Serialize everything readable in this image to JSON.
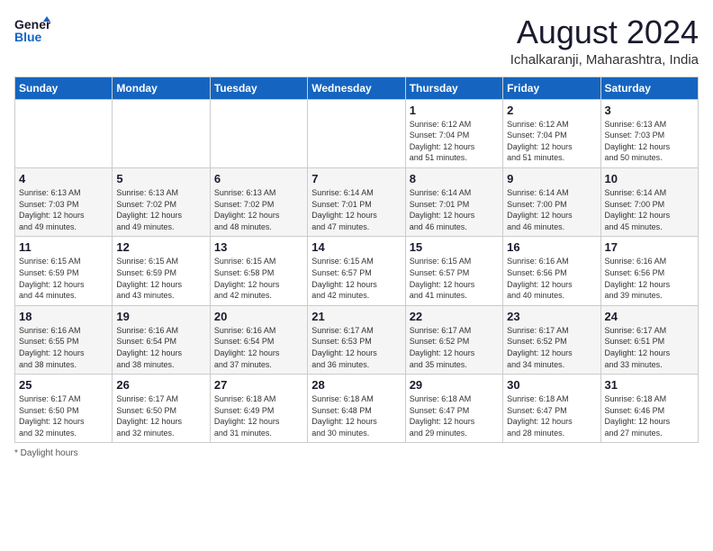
{
  "logo": {
    "line1": "General",
    "line2": "Blue"
  },
  "title": "August 2024",
  "location": "Ichalkaranji, Maharashtra, India",
  "days_of_week": [
    "Sunday",
    "Monday",
    "Tuesday",
    "Wednesday",
    "Thursday",
    "Friday",
    "Saturday"
  ],
  "footer": "Daylight hours",
  "weeks": [
    [
      {
        "day": "",
        "info": ""
      },
      {
        "day": "",
        "info": ""
      },
      {
        "day": "",
        "info": ""
      },
      {
        "day": "",
        "info": ""
      },
      {
        "day": "1",
        "info": "Sunrise: 6:12 AM\nSunset: 7:04 PM\nDaylight: 12 hours\nand 51 minutes."
      },
      {
        "day": "2",
        "info": "Sunrise: 6:12 AM\nSunset: 7:04 PM\nDaylight: 12 hours\nand 51 minutes."
      },
      {
        "day": "3",
        "info": "Sunrise: 6:13 AM\nSunset: 7:03 PM\nDaylight: 12 hours\nand 50 minutes."
      }
    ],
    [
      {
        "day": "4",
        "info": "Sunrise: 6:13 AM\nSunset: 7:03 PM\nDaylight: 12 hours\nand 49 minutes."
      },
      {
        "day": "5",
        "info": "Sunrise: 6:13 AM\nSunset: 7:02 PM\nDaylight: 12 hours\nand 49 minutes."
      },
      {
        "day": "6",
        "info": "Sunrise: 6:13 AM\nSunset: 7:02 PM\nDaylight: 12 hours\nand 48 minutes."
      },
      {
        "day": "7",
        "info": "Sunrise: 6:14 AM\nSunset: 7:01 PM\nDaylight: 12 hours\nand 47 minutes."
      },
      {
        "day": "8",
        "info": "Sunrise: 6:14 AM\nSunset: 7:01 PM\nDaylight: 12 hours\nand 46 minutes."
      },
      {
        "day": "9",
        "info": "Sunrise: 6:14 AM\nSunset: 7:00 PM\nDaylight: 12 hours\nand 46 minutes."
      },
      {
        "day": "10",
        "info": "Sunrise: 6:14 AM\nSunset: 7:00 PM\nDaylight: 12 hours\nand 45 minutes."
      }
    ],
    [
      {
        "day": "11",
        "info": "Sunrise: 6:15 AM\nSunset: 6:59 PM\nDaylight: 12 hours\nand 44 minutes."
      },
      {
        "day": "12",
        "info": "Sunrise: 6:15 AM\nSunset: 6:59 PM\nDaylight: 12 hours\nand 43 minutes."
      },
      {
        "day": "13",
        "info": "Sunrise: 6:15 AM\nSunset: 6:58 PM\nDaylight: 12 hours\nand 42 minutes."
      },
      {
        "day": "14",
        "info": "Sunrise: 6:15 AM\nSunset: 6:57 PM\nDaylight: 12 hours\nand 42 minutes."
      },
      {
        "day": "15",
        "info": "Sunrise: 6:15 AM\nSunset: 6:57 PM\nDaylight: 12 hours\nand 41 minutes."
      },
      {
        "day": "16",
        "info": "Sunrise: 6:16 AM\nSunset: 6:56 PM\nDaylight: 12 hours\nand 40 minutes."
      },
      {
        "day": "17",
        "info": "Sunrise: 6:16 AM\nSunset: 6:56 PM\nDaylight: 12 hours\nand 39 minutes."
      }
    ],
    [
      {
        "day": "18",
        "info": "Sunrise: 6:16 AM\nSunset: 6:55 PM\nDaylight: 12 hours\nand 38 minutes."
      },
      {
        "day": "19",
        "info": "Sunrise: 6:16 AM\nSunset: 6:54 PM\nDaylight: 12 hours\nand 38 minutes."
      },
      {
        "day": "20",
        "info": "Sunrise: 6:16 AM\nSunset: 6:54 PM\nDaylight: 12 hours\nand 37 minutes."
      },
      {
        "day": "21",
        "info": "Sunrise: 6:17 AM\nSunset: 6:53 PM\nDaylight: 12 hours\nand 36 minutes."
      },
      {
        "day": "22",
        "info": "Sunrise: 6:17 AM\nSunset: 6:52 PM\nDaylight: 12 hours\nand 35 minutes."
      },
      {
        "day": "23",
        "info": "Sunrise: 6:17 AM\nSunset: 6:52 PM\nDaylight: 12 hours\nand 34 minutes."
      },
      {
        "day": "24",
        "info": "Sunrise: 6:17 AM\nSunset: 6:51 PM\nDaylight: 12 hours\nand 33 minutes."
      }
    ],
    [
      {
        "day": "25",
        "info": "Sunrise: 6:17 AM\nSunset: 6:50 PM\nDaylight: 12 hours\nand 32 minutes."
      },
      {
        "day": "26",
        "info": "Sunrise: 6:17 AM\nSunset: 6:50 PM\nDaylight: 12 hours\nand 32 minutes."
      },
      {
        "day": "27",
        "info": "Sunrise: 6:18 AM\nSunset: 6:49 PM\nDaylight: 12 hours\nand 31 minutes."
      },
      {
        "day": "28",
        "info": "Sunrise: 6:18 AM\nSunset: 6:48 PM\nDaylight: 12 hours\nand 30 minutes."
      },
      {
        "day": "29",
        "info": "Sunrise: 6:18 AM\nSunset: 6:47 PM\nDaylight: 12 hours\nand 29 minutes."
      },
      {
        "day": "30",
        "info": "Sunrise: 6:18 AM\nSunset: 6:47 PM\nDaylight: 12 hours\nand 28 minutes."
      },
      {
        "day": "31",
        "info": "Sunrise: 6:18 AM\nSunset: 6:46 PM\nDaylight: 12 hours\nand 27 minutes."
      }
    ]
  ]
}
